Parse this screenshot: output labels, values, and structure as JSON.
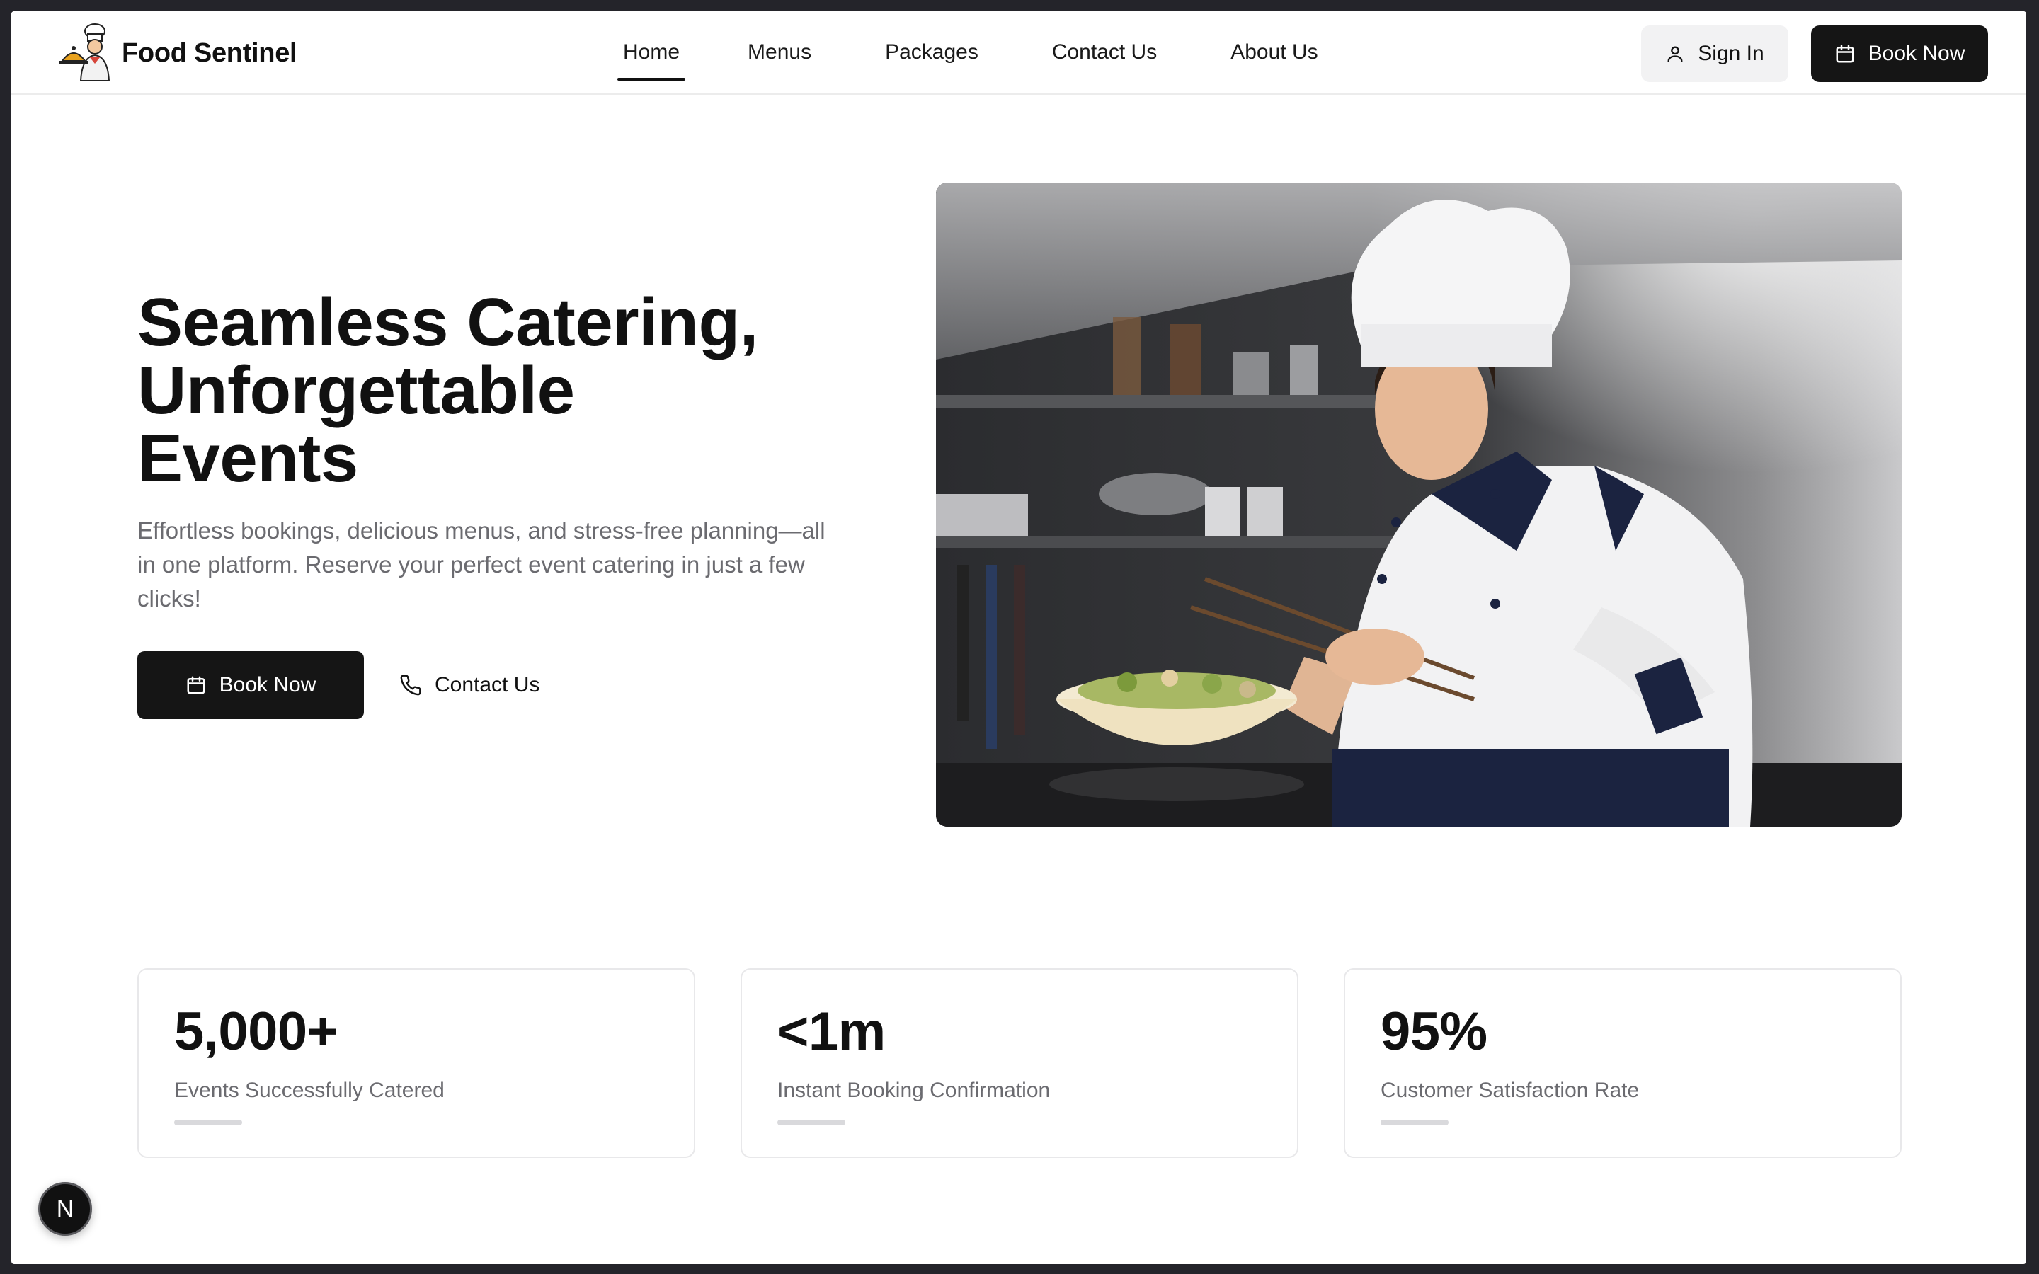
{
  "brand": {
    "name": "Food Sentinel"
  },
  "nav": {
    "items": [
      {
        "label": "Home",
        "active": true
      },
      {
        "label": "Menus"
      },
      {
        "label": "Packages"
      },
      {
        "label": "Contact Us"
      },
      {
        "label": "About Us"
      }
    ],
    "signin_label": "Sign In",
    "book_label": "Book Now"
  },
  "hero": {
    "title_line1": "Seamless Catering,",
    "title_line2": "Unforgettable",
    "title_line3": "Events",
    "description": "Effortless bookings, delicious menus, and stress-free planning—all in one platform. Reserve your perfect event catering in just a few clicks!",
    "book_label": "Book Now",
    "contact_label": "Contact Us"
  },
  "stats": [
    {
      "value": "5,000+",
      "label": "Events Successfully Catered"
    },
    {
      "value": "<1m",
      "label": "Instant Booking Confirmation"
    },
    {
      "value": "95%",
      "label": "Customer Satisfaction Rate"
    }
  ],
  "badge": {
    "letter": "N"
  },
  "colors": {
    "primary": "#151515",
    "muted_text": "#6b6b70",
    "border": "#e8e8ea",
    "signin_bg": "#f2f2f3",
    "frame": "#24242a"
  },
  "icons": {
    "signin": "user-icon",
    "book": "calendar-icon",
    "contact": "phone-icon",
    "logo": "chef-logo-icon"
  }
}
